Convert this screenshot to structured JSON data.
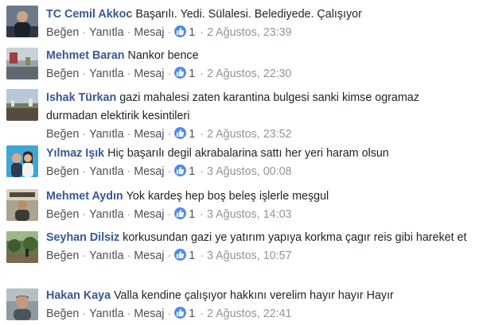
{
  "actions": {
    "like": "Beğen",
    "reply": "Yanıtla",
    "message": "Mesaj",
    "separator": "·"
  },
  "colors": {
    "name": "#385898",
    "like_badge": "#4a8bf7",
    "meta": "#90949c"
  },
  "comments": [
    {
      "author": "TC Cemil Akkoc",
      "text": "Başarılı. Yedi. Sülalesi. Belediyede. Çalışıyor",
      "likes": "1",
      "time": "2 Ağustos, 23:39",
      "avatar_icon": "person-avatar-icon"
    },
    {
      "author": "Mehmet Baran",
      "text": "Nankor bence",
      "likes": "1",
      "time": "2 Ağustos, 22:30",
      "avatar_icon": "landscape-avatar-icon"
    },
    {
      "author": "Ishak Türkan",
      "text": "gazi mahalesi zaten karantina bulgesi sanki kimse ogramaz durmadan elektirik kesintileri",
      "likes": "1",
      "time": "2 Ağustos, 23:52",
      "avatar_icon": "landscape-avatar-icon"
    },
    {
      "author": "Yılmaz Işık",
      "text": "Hiç başarılı degil akrabalarina sattı her yeri haram olsun",
      "likes": "1",
      "time": "3 Ağustos, 00:08",
      "avatar_icon": "couple-avatar-icon"
    },
    {
      "author": "Mehmet Aydın",
      "text": "Yok kardeş hep boş beleş işlerle meşgul",
      "likes": "1",
      "time": "3 Ağustos, 14:03",
      "avatar_icon": "person-avatar-icon"
    },
    {
      "author": "Seyhan Dilsiz",
      "text": "korkusundan gazi ye yatırım yapıya korkma çagır reis gibi hareket et",
      "likes": "1",
      "time": "3 Ağustos, 10:57",
      "avatar_icon": "nature-avatar-icon"
    },
    {
      "author": "Hakan Kaya",
      "text": "Valla kendine çalışıyor hakkını verelim hayır hayır Hayır",
      "likes": "1",
      "time": "2 Ağustos, 22:41",
      "avatar_icon": "person-avatar-icon"
    }
  ]
}
